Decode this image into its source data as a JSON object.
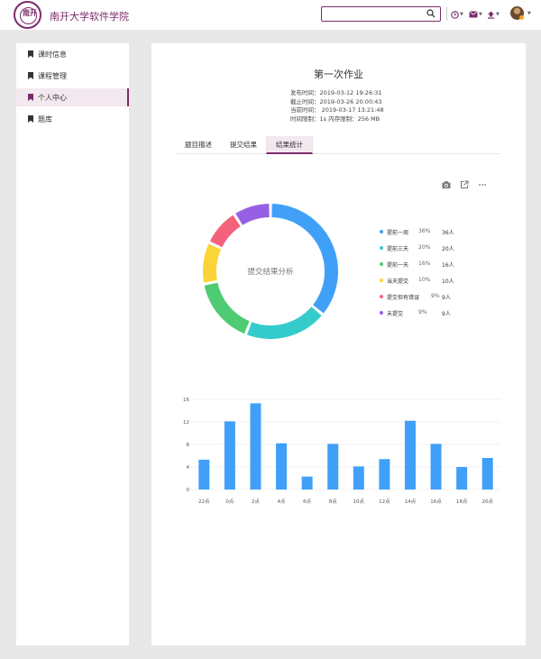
{
  "header": {
    "logo_text": "南开",
    "title": "南开大学软件学院",
    "search": {
      "value": "",
      "placeholder": ""
    },
    "colors": {
      "brand": "#7b2b6b"
    }
  },
  "sidebar": {
    "items": [
      {
        "label": "课时信息",
        "active": false
      },
      {
        "label": "课程管理",
        "active": false
      },
      {
        "label": "个人中心",
        "active": true
      },
      {
        "label": "题库",
        "active": false
      }
    ]
  },
  "assignment": {
    "title": "第一次作业",
    "publish_time": "发布时间：2019-03-12 19:26:31",
    "deadline": "截止时间：2019-03-26 20:00:43",
    "current_time": "当前时间： 2019-03-17 13:21:48",
    "limits": "时间限制：1s  内存限制：256 MB"
  },
  "tabs": [
    {
      "label": "题目描述",
      "active": false
    },
    {
      "label": "提交结果",
      "active": false
    },
    {
      "label": "结果统计",
      "active": true
    }
  ],
  "toolbar_icons": [
    "camera-icon",
    "export-icon",
    "more-icon"
  ],
  "chart_data": [
    {
      "type": "pie",
      "center_label": "提交结果分析",
      "slices": [
        {
          "name": "提前一周",
          "percent": "36%",
          "count": "36人",
          "value": 36,
          "color": "#40a0f8"
        },
        {
          "name": "提前三天",
          "percent": "20%",
          "count": "20人",
          "value": 20,
          "color": "#36cbcb"
        },
        {
          "name": "提前一天",
          "percent": "16%",
          "count": "16人",
          "value": 16,
          "color": "#4ecb73"
        },
        {
          "name": "当天提交",
          "percent": "10%",
          "count": "10人",
          "value": 10,
          "color": "#fbd437"
        },
        {
          "name": "提交但有错误",
          "percent": "9%",
          "count": "9人",
          "value": 9,
          "color": "#f2637b"
        },
        {
          "name": "未提交",
          "percent": "9%",
          "count": "9人",
          "value": 9,
          "color": "#975fe5"
        }
      ]
    },
    {
      "type": "bar",
      "categories": [
        "22点",
        "0点",
        "2点",
        "4点",
        "6点",
        "8点",
        "10点",
        "12点",
        "14点",
        "16点",
        "18点",
        "20点"
      ],
      "values": [
        5.3,
        12.1,
        15.3,
        8.2,
        2.3,
        8.1,
        4.1,
        5.4,
        12.2,
        8.1,
        4.0,
        5.6
      ],
      "ylim": [
        0,
        16
      ],
      "yticks": [
        "0",
        "4",
        "8",
        "12",
        "16"
      ],
      "grid": true,
      "bar_color": "#40a0f8"
    }
  ]
}
